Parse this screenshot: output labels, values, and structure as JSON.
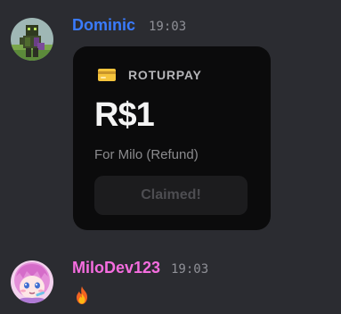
{
  "messages": [
    {
      "username": "Dominic",
      "timestamp": "19:03",
      "username_color": "#3a7bfd",
      "avatar_icon": "pixel-character-avatar"
    },
    {
      "username": "MiloDev123",
      "timestamp": "19:03",
      "username_color": "#f56ddf",
      "avatar_icon": "pink-anime-character-avatar",
      "content_icon": "fire-emoji"
    }
  ],
  "payment_card": {
    "icon": "credit-card-icon",
    "brand": "ROTURPAY",
    "amount": "R$1",
    "description": "For Milo (Refund)",
    "button_label": "Claimed!",
    "button_state": "disabled"
  },
  "colors": {
    "background": "#2b2c31",
    "card_background": "#0b0b0c",
    "timestamp": "#8f9097"
  }
}
